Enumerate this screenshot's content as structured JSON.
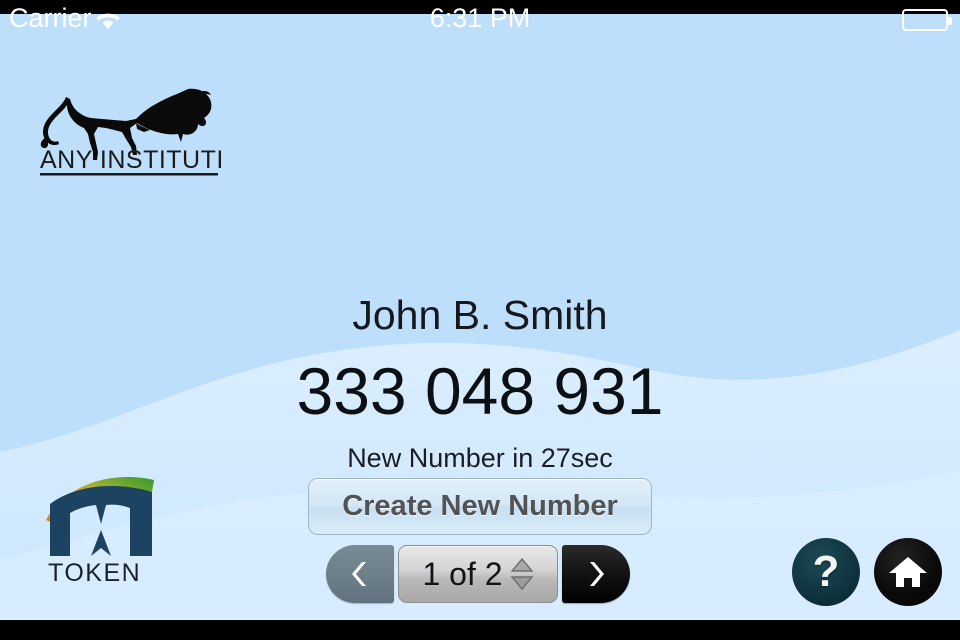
{
  "status_bar": {
    "carrier": "Carrier",
    "wifi_icon": "wifi-icon",
    "time": "6:31 PM",
    "battery_icon": "battery-full-icon"
  },
  "institution": {
    "logo_icon": "lion-silhouette-icon",
    "name": "ANY INSTITUTION"
  },
  "brand": {
    "logo_icon": "m-swoosh-icon",
    "mark": "M",
    "registered": "®",
    "name": "TOKEN"
  },
  "main": {
    "user_name": "John B. Smith",
    "token_code": "333 048 931",
    "countdown": "New Number in 27sec",
    "create_button": "Create New Number"
  },
  "pager": {
    "prev_icon": "chevron-left-icon",
    "page_label": "1 of 2",
    "current_page": 1,
    "total_pages": 2,
    "stepper_up_icon": "triangle-up-icon",
    "stepper_down_icon": "triangle-down-icon",
    "next_icon": "chevron-right-icon"
  },
  "actions": {
    "help_glyph": "?",
    "help_icon": "question-mark-icon",
    "home_icon": "house-icon"
  },
  "colors": {
    "background": "#bedffb",
    "wave_light": "#d7ecfd",
    "status_bar": "#000000",
    "brand_navy": "#1d4363",
    "swoosh_orange": "#e8972c",
    "swoosh_green": "#3e9a33",
    "prev_button": "#6d808a",
    "next_button": "#0d0d0d",
    "help_button": "#103540",
    "text_dark": "#12171b"
  }
}
